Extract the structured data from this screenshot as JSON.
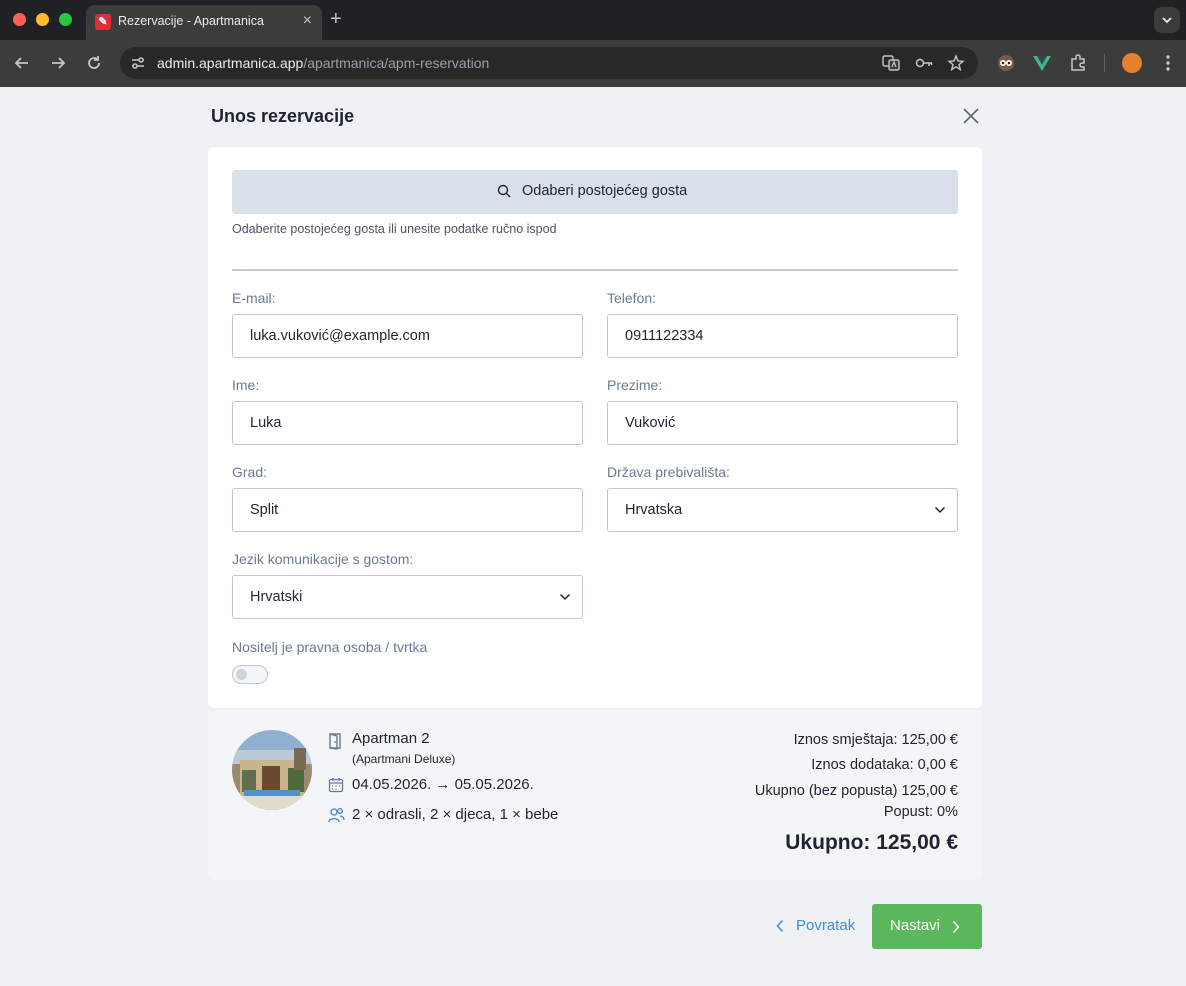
{
  "browser": {
    "tab_title": "Rezervacije - Apartmanica",
    "url_host": "admin.apartmanica.app",
    "url_path": "/apartmanica/apm-reservation"
  },
  "page": {
    "title": "Unos rezervacije"
  },
  "guest_picker": {
    "button_label": "Odaberi postojećeg gosta",
    "hint": "Odaberite postojećeg gosta ili unesite podatke ručno ispod"
  },
  "form": {
    "email": {
      "label": "E-mail:",
      "value": "luka.vuković@example.com"
    },
    "phone": {
      "label": "Telefon:",
      "value": "0911122334"
    },
    "first_name": {
      "label": "Ime:",
      "value": "Luka"
    },
    "last_name": {
      "label": "Prezime:",
      "value": "Vuković"
    },
    "city": {
      "label": "Grad:",
      "value": "Split"
    },
    "country": {
      "label": "Država prebivališta:",
      "value": "Hrvatska"
    },
    "language": {
      "label": "Jezik komunikacije s gostom:",
      "value": "Hrvatski"
    },
    "company_toggle": {
      "label": "Nositelj je pravna osoba / tvrtka",
      "checked": false
    }
  },
  "summary": {
    "apartment_name": "Apartman 2",
    "apartment_type": "(Apartmani Deluxe)",
    "dates": "04.05.2026. → 05.05.2026.",
    "guests": "2 × odrasli, 2 × djeca, 1 × bebe",
    "accommodation_amount": "Iznos smještaja: 125,00 €",
    "extras_amount": "Iznos dodataka: 0,00 €",
    "subtotal": "Ukupno (bez popusta) 125,00 €",
    "discount": "Popust: 0%",
    "total": "Ukupno: 125,00 €"
  },
  "actions": {
    "back_label": "Povratak",
    "next_label": "Nastavi"
  },
  "colors": {
    "primary_green": "#5cb85c",
    "link_blue": "#3d8ed9",
    "picker_bg": "#d9e0ea",
    "label_gray": "#6b7a93"
  }
}
